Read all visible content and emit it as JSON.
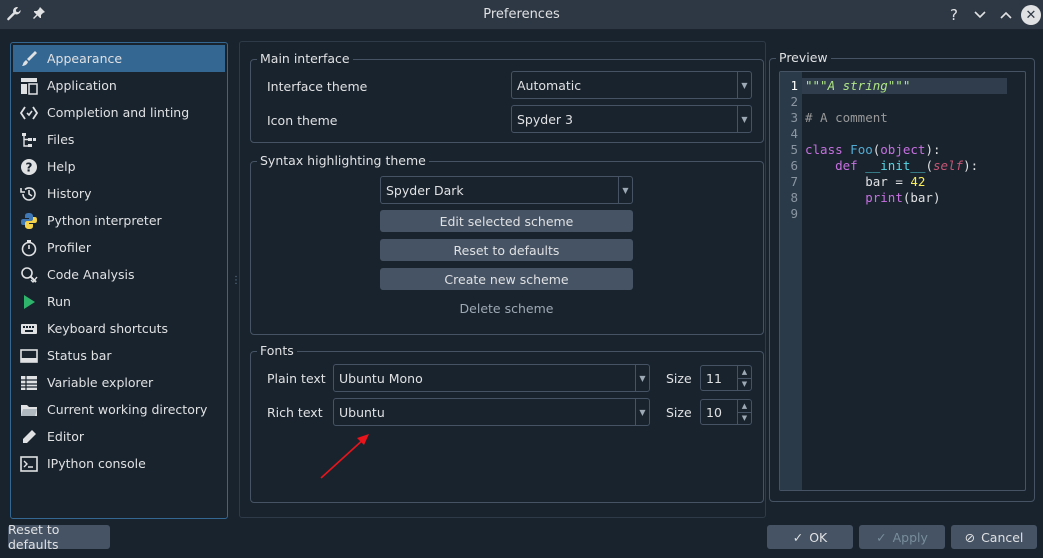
{
  "window": {
    "title": "Preferences"
  },
  "sidebar": {
    "items": [
      {
        "label": "Appearance",
        "icon": "brush-icon",
        "selected": true
      },
      {
        "label": "Application",
        "icon": "application-icon"
      },
      {
        "label": "Completion and linting",
        "icon": "completion-icon"
      },
      {
        "label": "Files",
        "icon": "files-icon"
      },
      {
        "label": "Help",
        "icon": "help-icon"
      },
      {
        "label": "History",
        "icon": "history-icon"
      },
      {
        "label": "Python interpreter",
        "icon": "python-icon"
      },
      {
        "label": "Profiler",
        "icon": "stopwatch-icon"
      },
      {
        "label": "Code Analysis",
        "icon": "code-analysis-icon"
      },
      {
        "label": "Run",
        "icon": "play-icon"
      },
      {
        "label": "Keyboard shortcuts",
        "icon": "keyboard-icon"
      },
      {
        "label": "Status bar",
        "icon": "status-bar-icon"
      },
      {
        "label": "Variable explorer",
        "icon": "table-icon"
      },
      {
        "label": "Current working directory",
        "icon": "folder-icon"
      },
      {
        "label": "Editor",
        "icon": "pencil-icon"
      },
      {
        "label": "IPython console",
        "icon": "terminal-icon"
      }
    ]
  },
  "main_interface": {
    "title": "Main interface",
    "interface_theme_label": "Interface theme",
    "interface_theme_value": "Automatic",
    "icon_theme_label": "Icon theme",
    "icon_theme_value": "Spyder 3"
  },
  "syntax": {
    "title": "Syntax highlighting theme",
    "scheme_value": "Spyder Dark",
    "edit_label": "Edit selected scheme",
    "reset_label": "Reset to defaults",
    "create_label": "Create new scheme",
    "delete_label": "Delete scheme"
  },
  "fonts": {
    "title": "Fonts",
    "plain_label": "Plain text",
    "plain_value": "Ubuntu Mono",
    "plain_size_label": "Size",
    "plain_size": "11",
    "rich_label": "Rich text",
    "rich_value": "Ubuntu",
    "rich_size_label": "Size",
    "rich_size": "10"
  },
  "preview": {
    "title": "Preview",
    "line_numbers": [
      "1",
      "2",
      "3",
      "4",
      "5",
      "6",
      "7",
      "8",
      "9"
    ],
    "code": {
      "l1": "\"\"\"A string\"\"\"",
      "l3": "# A comment",
      "l5_kw": "class",
      "l5_cls": "Foo",
      "l5_arg": "object",
      "l6_kw": "def",
      "l6_fn": "__init__",
      "l6_self": "self",
      "l7_var": "bar = ",
      "l7_num": "42",
      "l8_fn": "print",
      "l8_arg": "(bar)"
    }
  },
  "footer": {
    "reset_label": "Reset to defaults",
    "ok_label": "OK",
    "apply_label": "Apply",
    "cancel_label": "Cancel"
  },
  "colors": {
    "background": "#19232d",
    "selection": "#346792",
    "button": "#455364",
    "annotation_arrow": "#e8141b"
  }
}
